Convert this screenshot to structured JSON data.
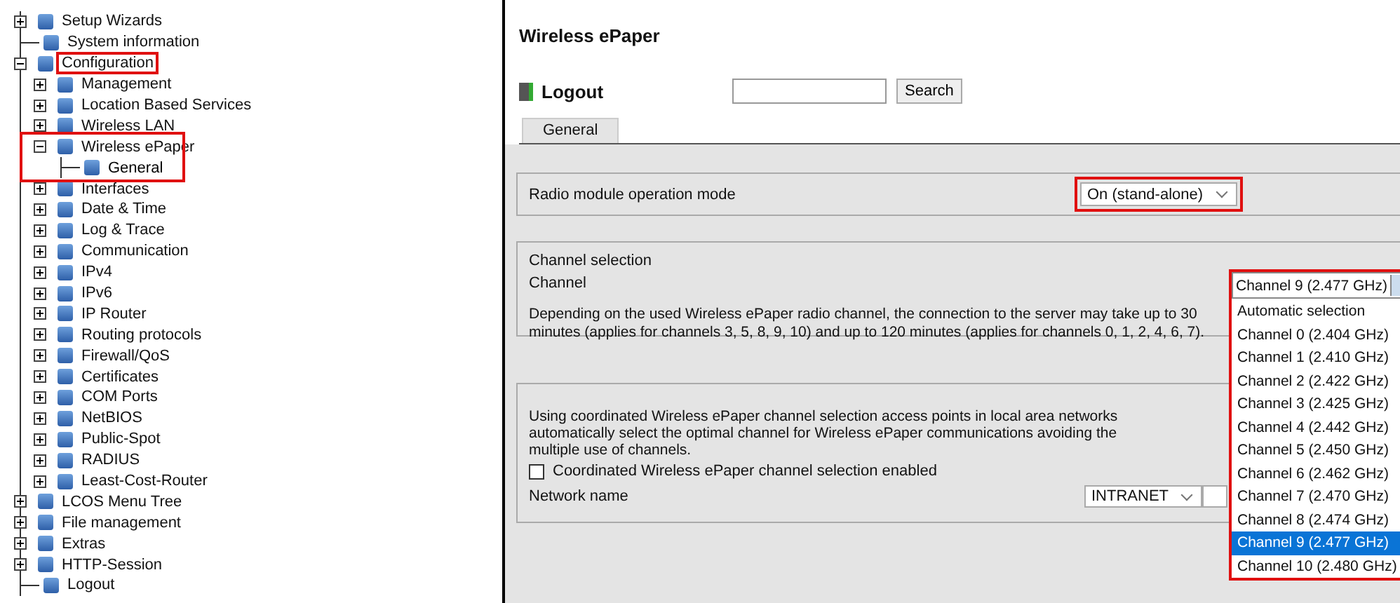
{
  "tree": [
    {
      "label": "Setup Wizards",
      "expanded": false,
      "highlighted": false
    },
    {
      "label": "System information",
      "highlighted": false
    },
    {
      "label": "Configuration",
      "expanded": true,
      "highlighted": true,
      "children": [
        {
          "label": "Management",
          "expanded": false,
          "highlighted": false
        },
        {
          "label": "Location Based Services",
          "expanded": false,
          "highlighted": false
        },
        {
          "label": "Wireless LAN",
          "expanded": false,
          "highlighted": false
        },
        {
          "label": "Wireless ePaper",
          "expanded": true,
          "highlighted": true,
          "children": [
            {
              "label": "General",
              "highlighted": true
            }
          ]
        },
        {
          "label": "Interfaces",
          "expanded": false,
          "highlighted": false
        },
        {
          "label": "Date & Time",
          "expanded": false,
          "highlighted": false
        },
        {
          "label": "Log & Trace",
          "expanded": false,
          "highlighted": false
        },
        {
          "label": "Communication",
          "expanded": false,
          "highlighted": false
        },
        {
          "label": "IPv4",
          "expanded": false,
          "highlighted": false
        },
        {
          "label": "IPv6",
          "expanded": false,
          "highlighted": false
        },
        {
          "label": "IP Router",
          "expanded": false,
          "highlighted": false
        },
        {
          "label": "Routing protocols",
          "expanded": false,
          "highlighted": false
        },
        {
          "label": "Firewall/QoS",
          "expanded": false,
          "highlighted": false
        },
        {
          "label": "Certificates",
          "expanded": false,
          "highlighted": false
        },
        {
          "label": "COM Ports",
          "expanded": false,
          "highlighted": false
        },
        {
          "label": "NetBIOS",
          "expanded": false,
          "highlighted": false
        },
        {
          "label": "Public-Spot",
          "expanded": false,
          "highlighted": false
        },
        {
          "label": "RADIUS",
          "expanded": false,
          "highlighted": false
        },
        {
          "label": "Least-Cost-Router",
          "expanded": false,
          "highlighted": false
        }
      ]
    },
    {
      "label": "LCOS Menu Tree",
      "expanded": false,
      "highlighted": false
    },
    {
      "label": "File management",
      "expanded": false,
      "highlighted": false
    },
    {
      "label": "Extras",
      "expanded": false,
      "highlighted": false
    },
    {
      "label": "HTTP-Session",
      "expanded": false,
      "highlighted": false
    },
    {
      "label": "Logout",
      "highlighted": false
    }
  ],
  "page": {
    "title": "Wireless ePaper",
    "logout": "Logout",
    "search_button": "Search"
  },
  "tabs": [
    {
      "label": "General",
      "selected": true
    }
  ],
  "operation_mode": {
    "label": "Radio module operation mode",
    "value": "On (stand-alone)",
    "highlighted": true
  },
  "channel_selection": {
    "heading": "Channel selection",
    "label": "Channel",
    "value": "Channel 9 (2.477 GHz)",
    "highlighted": true,
    "expanded": true,
    "note": "Depending on the used Wireless ePaper radio channel, the connection to the server may take up to 30 minutes (applies for channels 3, 5, 8, 9, 10) and up to 120 minutes (applies for channels 0, 1, 2, 4, 6, 7).",
    "options": [
      {
        "label": "Automatic selection",
        "selected": false
      },
      {
        "label": "Channel 0 (2.404 GHz)",
        "selected": false
      },
      {
        "label": "Channel 1 (2.410 GHz)",
        "selected": false
      },
      {
        "label": "Channel 2 (2.422 GHz)",
        "selected": false
      },
      {
        "label": "Channel 3 (2.425 GHz)",
        "selected": false
      },
      {
        "label": "Channel 4 (2.442 GHz)",
        "selected": false
      },
      {
        "label": "Channel 5 (2.450 GHz)",
        "selected": false
      },
      {
        "label": "Channel 6 (2.462 GHz)",
        "selected": false
      },
      {
        "label": "Channel 7 (2.470 GHz)",
        "selected": false
      },
      {
        "label": "Channel 8 (2.474 GHz)",
        "selected": false
      },
      {
        "label": "Channel 9 (2.477 GHz)",
        "selected": true
      },
      {
        "label": "Channel 10 (2.480 GHz)",
        "selected": false
      }
    ]
  },
  "coordination": {
    "description": "Using coordinated Wireless ePaper channel selection access points in local area networks automatically select the optimal channel for Wireless ePaper communications avoiding the multiple use of channels.",
    "checkbox": {
      "label": "Coordinated Wireless ePaper channel selection enabled",
      "checked": false
    },
    "network_label": "Network name",
    "network_value": "INTRANET"
  }
}
